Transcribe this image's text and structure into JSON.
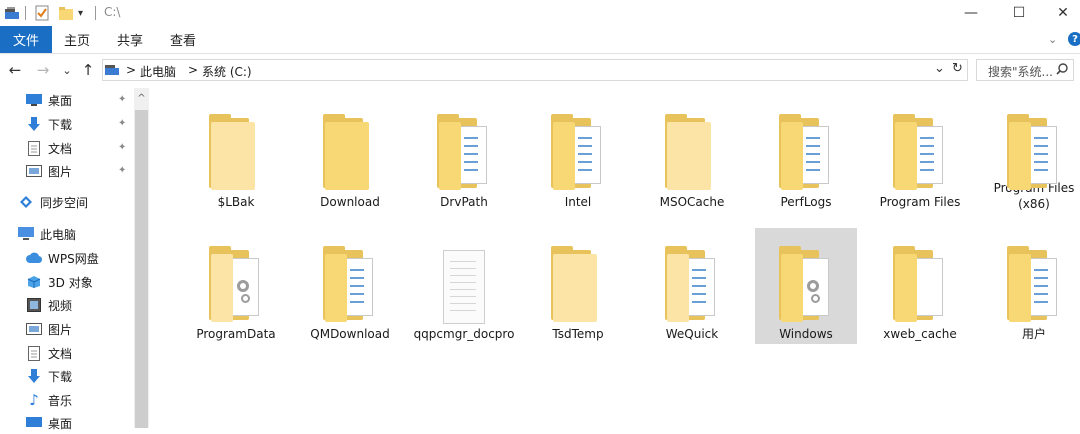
{
  "window": {
    "title_path": "C:\\",
    "controls": {
      "minimize": "—",
      "maximize": "☐",
      "close": "✕"
    }
  },
  "ribbon": {
    "tabs": [
      "文件",
      "主页",
      "共享",
      "查看"
    ],
    "expand_icon": "chevron-down-icon",
    "help_label": "?"
  },
  "addressbar": {
    "crumbs": [
      "此电脑",
      "系统 (C:)"
    ],
    "separator": ">",
    "search_placeholder": "搜索\"系统...",
    "dropdown": "⌄",
    "refresh": "↻"
  },
  "nav_pane": {
    "quick_access": [
      {
        "label": "桌面",
        "icon": "desktop-icon",
        "pinned": true
      },
      {
        "label": "下载",
        "icon": "download-icon",
        "pinned": true
      },
      {
        "label": "文档",
        "icon": "document-icon",
        "pinned": true
      },
      {
        "label": "图片",
        "icon": "picture-icon",
        "pinned": true
      }
    ],
    "sync": {
      "label": "同步空间",
      "icon": "sync-icon"
    },
    "this_pc": {
      "label": "此电脑",
      "icon": "computer-icon"
    },
    "this_pc_items": [
      {
        "label": "WPS网盘",
        "icon": "cloud-icon"
      },
      {
        "label": "3D 对象",
        "icon": "cube-icon"
      },
      {
        "label": "视频",
        "icon": "video-icon"
      },
      {
        "label": "图片",
        "icon": "picture-icon"
      },
      {
        "label": "文档",
        "icon": "document-icon"
      },
      {
        "label": "下载",
        "icon": "download-icon"
      },
      {
        "label": "音乐",
        "icon": "music-icon"
      },
      {
        "label": "桌面",
        "icon": "desktop-icon"
      }
    ]
  },
  "folders": [
    {
      "name": "$LBak",
      "style": "plain-light"
    },
    {
      "name": "Download",
      "style": "plain"
    },
    {
      "name": "DrvPath",
      "style": "docs"
    },
    {
      "name": "Intel",
      "style": "docs"
    },
    {
      "name": "MSOCache",
      "style": "plain-light"
    },
    {
      "name": "PerfLogs",
      "style": "docs"
    },
    {
      "name": "Program Files",
      "style": "docs"
    },
    {
      "name": "Program Files (x86)",
      "style": "docs"
    },
    {
      "name": "ProgramData",
      "style": "gear-light"
    },
    {
      "name": "QMDownload",
      "style": "docs"
    },
    {
      "name": "qqpcmgr_docpro",
      "style": "file"
    },
    {
      "name": "TsdTemp",
      "style": "plain-light"
    },
    {
      "name": "WeQuick",
      "style": "docs-light"
    },
    {
      "name": "Windows",
      "style": "gear",
      "selected": true
    },
    {
      "name": "xweb_cache",
      "style": "paper"
    },
    {
      "name": "用户",
      "style": "docs"
    }
  ],
  "colors": {
    "accent": "#1a6fc4",
    "folder": "#f8d775",
    "selection": "#d9d9d9"
  }
}
